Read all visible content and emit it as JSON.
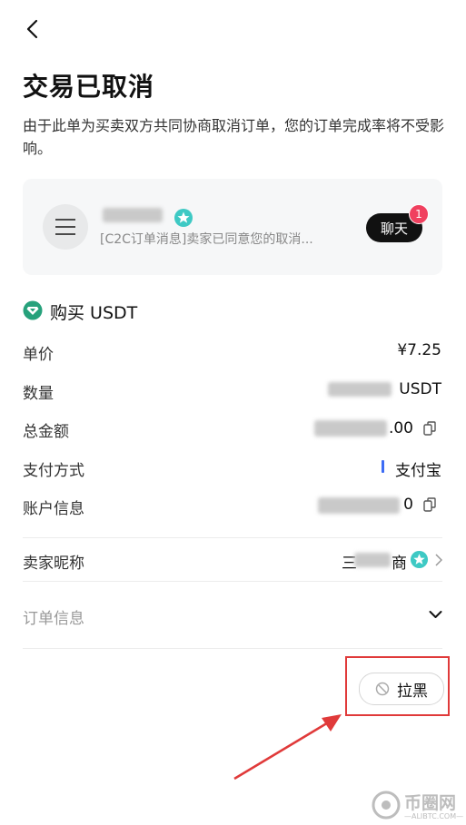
{
  "header": {
    "back_icon": "chevron-left-icon"
  },
  "title": "交易已取消",
  "description": "由于此单为买卖双方共同协商取消订单，您的订单完成率将不受影响。",
  "chat_card": {
    "message_preview": "[C2C订单消息]卖家已同意您的取消...",
    "chat_label": "聊天",
    "unread_count": "1"
  },
  "order": {
    "section_title": "购买 USDT",
    "unit_price_label": "单价",
    "unit_price_value": "¥7.25",
    "quantity_label": "数量",
    "quantity_unit": "USDT",
    "total_label": "总金额",
    "total_suffix": ".00",
    "payment_label": "支付方式",
    "payment_value": "支付宝",
    "account_label": "账户信息",
    "account_suffix": "0",
    "seller_label": "卖家昵称",
    "seller_prefix": "三",
    "seller_suffix": "商",
    "order_info_label": "订单信息"
  },
  "actions": {
    "block_label": "拉黑"
  },
  "watermark": {
    "brand": "币圈网",
    "domain": "—ALIBTC.COM—"
  },
  "colors": {
    "accent_blue": "#3d6cf5",
    "badge_red": "#f0405f",
    "annotation_red": "#e03a3a",
    "tether_teal": "#26a17b"
  }
}
